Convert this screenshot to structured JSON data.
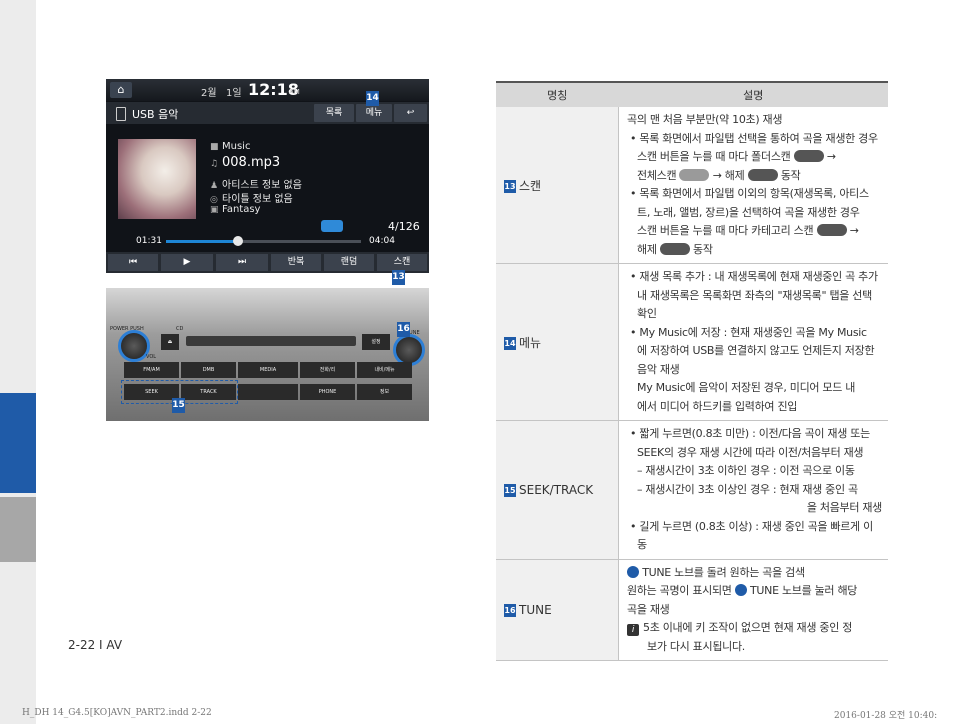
{
  "screen": {
    "month": "2월",
    "day": "1일",
    "clock": "12:18",
    "ampm": "AM",
    "source_title": "USB 음악",
    "header_buttons": [
      "목록",
      "메뉴"
    ],
    "back_icon": "back-arrow-icon",
    "folder": "Music",
    "filename": "008.mp3",
    "artist": "아티스트 정보 없음",
    "song_title": "타이틀 정보 없음",
    "album": "Fantasy",
    "track_count": "4/126",
    "elapsed": "01:31",
    "total": "04:04",
    "progress_fraction": 0.37,
    "controls": [
      "반복",
      "랜덤",
      "스캔"
    ]
  },
  "unit": {
    "left_knob_labels": [
      "POWER PUSH",
      "VOL"
    ],
    "right_knob_label": "TUNE",
    "cd_label": "CD",
    "buttons_row1": [
      "FM/AM",
      "DMB",
      "MEDIA",
      "전화/리",
      "내비/메뉴"
    ],
    "buttons_row2": [
      "SEEK",
      "TRACK",
      "",
      "PHONE",
      "정보"
    ],
    "eject_label": "설정"
  },
  "badges": {
    "b13": "13",
    "b14": "14",
    "b15": "15",
    "b16": "16"
  },
  "table": {
    "head_name": "명칭",
    "head_desc": "설명",
    "rows": [
      {
        "badge": "13",
        "name": "스캔",
        "lines": [
          "곡의 맨 처음 부분만(약 10초) 재생",
          "• 목록 화면에서 파일탭 선택을 통하여 곡을 재생한 경우",
          "스캔 버튼을 누를 때 마다 폴더스캔",
          "→",
          "전체스캔",
          "→ 해제",
          "동작",
          "• 목록 화면에서 파일탭 이외의 항목(재생목록, 아티스",
          "트, 노래, 앨범, 장르)을 선택하여 곡을 재생한 경우",
          "스캔 버튼을 누를 때 마다 카테고리 스캔",
          "→",
          "해제",
          "동작"
        ]
      },
      {
        "badge": "14",
        "name": "메뉴",
        "lines": [
          "• 재생 목록 추가 : 내 재생목록에 현재 재생중인 곡 추가",
          "내 재생목록은 목록화면 좌측의 \"재생목록\" 탭을 선택 확인",
          "• My Music에 저장 : 현재 재생중인 곡을 My Music",
          "에 저장하여 USB를 연결하지 않고도 언제든지 저장한",
          "음악 재생",
          "My Music에 음악이 저장된 경우, 미디어 모드 내",
          "에서 미디어 하드키를 입력하여 진입"
        ]
      },
      {
        "badge": "15",
        "name": "SEEK/TRACK",
        "lines": [
          "• 짧게 누르면(0.8초 미만) : 이전/다음 곡이 재생 또는",
          "SEEK의 경우 재생 시간에 따라 이전/처음부터 재생",
          "– 재생시간이 3초 이하인 경우 : 이전 곡으로 이동",
          "– 재생시간이 3초 이상인 경우 : 현재 재생 중인 곡",
          "을 처음부터 재생",
          "• 길게 누르면 (0.8초 이상) : 재생 중인 곡을 빠르게 이동"
        ]
      },
      {
        "badge": "16",
        "name": "TUNE",
        "lines": [
          "TUNE 노브를 돌려 원하는 곡을 검색",
          "원하는 곡명이 표시되면",
          "TUNE 노브를 눌러 해당",
          "곡을 재생",
          "5초 이내에 키 조작이 없으면 현재 재생 중인 정",
          "보가 다시 표시됩니다."
        ]
      }
    ]
  },
  "page_number": "2-22 I AV",
  "footer_left": "H_DH 14_G4.5[KO]AVN_PART2.indd   2-22",
  "footer_right": "2016-01-28   오전 10:40:",
  "colors": {
    "accent": "#1f5ba8",
    "sidebar": "#ececec"
  }
}
